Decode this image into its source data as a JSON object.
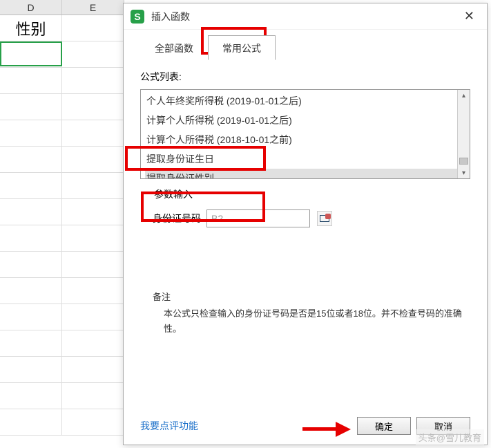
{
  "sheet": {
    "cols": [
      "D",
      "E"
    ],
    "d1": "性别"
  },
  "dialog": {
    "title": "插入函数",
    "tabs": {
      "all": "全部函数",
      "common": "常用公式"
    },
    "formula_list_label": "公式列表:",
    "items": [
      "个人年终奖所得税 (2019-01-01之后)",
      "计算个人所得税 (2019-01-01之后)",
      "计算个人所得税 (2018-10-01之前)",
      "提取身份证生日",
      "提取身份证性别"
    ],
    "params": {
      "legend": "参数输入",
      "id_label": "身份证号码",
      "id_value": "B2"
    },
    "note": {
      "title": "备注",
      "body": "本公式只检查输入的身份证号码是否是15位或者18位。并不检查号码的准确性。"
    },
    "footer": {
      "feedback": "我要点评功能",
      "ok": "确定",
      "cancel": "取消"
    }
  },
  "watermark": "头条@雪儿教育"
}
